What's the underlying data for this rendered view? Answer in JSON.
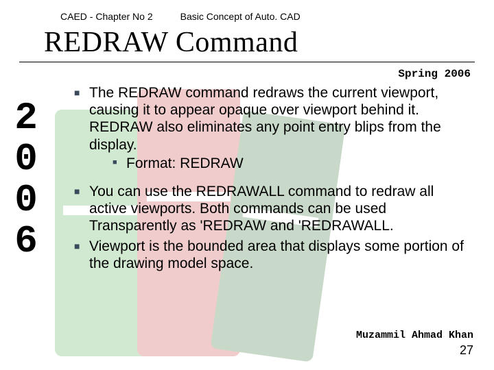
{
  "header": {
    "left": "CAED  - Chapter No 2",
    "right": "Basic Concept of Auto. CAD"
  },
  "title": "REDRAW Command",
  "springLabel": "Spring 2006",
  "yearVertical": "2006",
  "bullets": {
    "b1_text": "The REDRAW command redraws the current viewport, causing it to appear opaque over viewport behind it. REDRAW also eliminates any point entry blips from the display.",
    "b1_sub": "Format:  REDRAW",
    "b2_text": "You can use the REDRAWALL command to redraw all active viewports. Both commands can be used Transparently as 'REDRAW and 'REDRAWALL.",
    "b3_text": "Viewport is the bounded area that displays some portion of the drawing model space."
  },
  "footer": {
    "author": "Muzammil Ahmad Khan",
    "page": "27"
  }
}
